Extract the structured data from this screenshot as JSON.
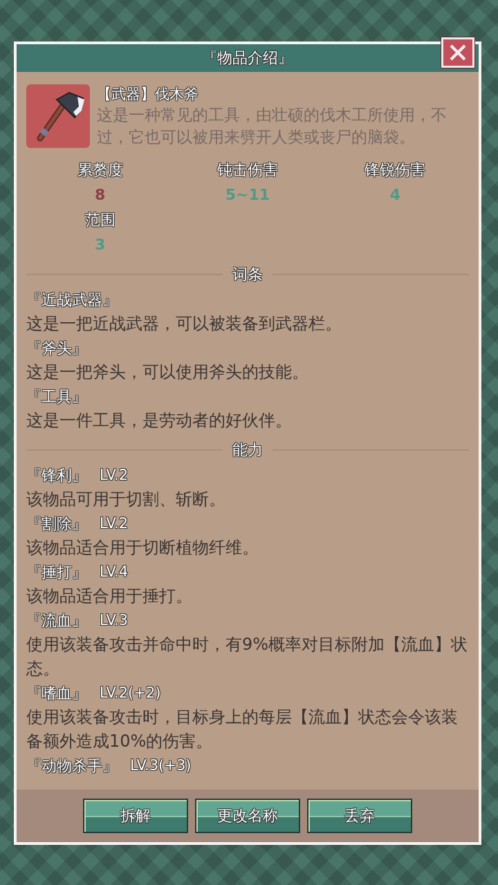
{
  "window": {
    "title": "『物品介绍』"
  },
  "item": {
    "name": "【武器】伐木斧",
    "description": "这是一种常见的工具，由壮硕的伐木工所使用，不过，它也可以被用来劈开人类或丧尸的脑袋。"
  },
  "stats": [
    {
      "label": "累赘度",
      "value": "8",
      "color": "#8c3f48"
    },
    {
      "label": "钝击伤害",
      "value": "5~11",
      "color": "#4f9a88"
    },
    {
      "label": "锋锐伤害",
      "value": "4",
      "color": "#4f9a88"
    },
    {
      "label": "范围",
      "value": "3",
      "color": "#4f9a88"
    }
  ],
  "sections": [
    {
      "title": "词条",
      "entries": [
        {
          "name": "『近战武器』",
          "description": "这是一把近战武器，可以被装备到武器栏。"
        },
        {
          "name": "『斧头』",
          "description": "这是一把斧头，可以使用斧头的技能。"
        },
        {
          "name": "『工具』",
          "description": "这是一件工具，是劳动者的好伙伴。"
        }
      ]
    },
    {
      "title": "能力",
      "entries": [
        {
          "name": "『锋利』",
          "level": "LV.2",
          "description": "该物品可用于切割、斩断。"
        },
        {
          "name": "『割除』",
          "level": "LV.2",
          "description": "该物品适合用于切断植物纤维。"
        },
        {
          "name": "『捶打』",
          "level": "LV.4",
          "description": "该物品适合用于捶打。"
        },
        {
          "name": "『流血』",
          "level": "LV.3",
          "description": "使用该装备攻击并命中时，有9%概率对目标附加【流血】状态。"
        },
        {
          "name": "『嗜血』",
          "level": "LV.2(+2)",
          "description": "使用该装备攻击时，目标身上的每层【流血】状态会令该装备额外造成10%的伤害。"
        },
        {
          "name": "『动物杀手』",
          "level": "LV.3(+3)"
        }
      ]
    }
  ],
  "buttons": [
    "拆解",
    "更改名称",
    "丢弃"
  ]
}
